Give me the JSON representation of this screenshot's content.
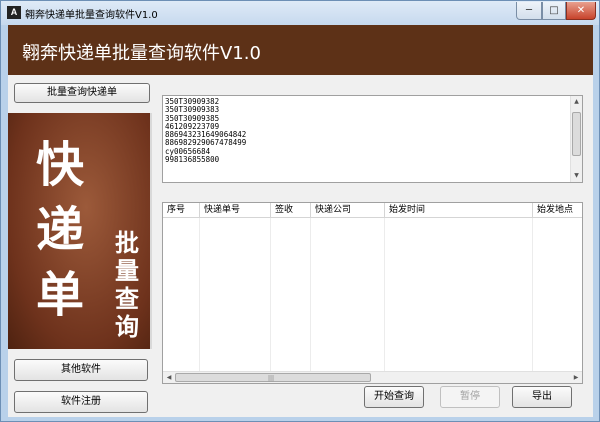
{
  "window": {
    "title": "翱奔快递单批量查询软件V1.0",
    "min_glyph": "─",
    "max_glyph": "□",
    "close_glyph": "✕",
    "app_icon_glyph": "A"
  },
  "banner": {
    "title": "翱奔快递单批量查询软件V1.0"
  },
  "sidebar": {
    "batch_query_label": "批量查询快递单",
    "image_big_chars": [
      "快",
      "递",
      "单"
    ],
    "image_small_chars": [
      "批",
      "量",
      "查",
      "询"
    ],
    "other_software_label": "其他软件",
    "register_label": "软件注册"
  },
  "input_box": {
    "lines": [
      "350T30909382",
      "350T30909383",
      "350T30909385",
      "461209223709",
      "886943231649064842",
      "886982929067478499",
      "cy00656684",
      "998136855800"
    ]
  },
  "results_table": {
    "columns": [
      "序号",
      "快递单号",
      "签收",
      "快递公司",
      "始发时间",
      "始发地点"
    ]
  },
  "footer": {
    "start_label": "开始查询",
    "disabled_label": "暂停",
    "export_label": "导出"
  }
}
